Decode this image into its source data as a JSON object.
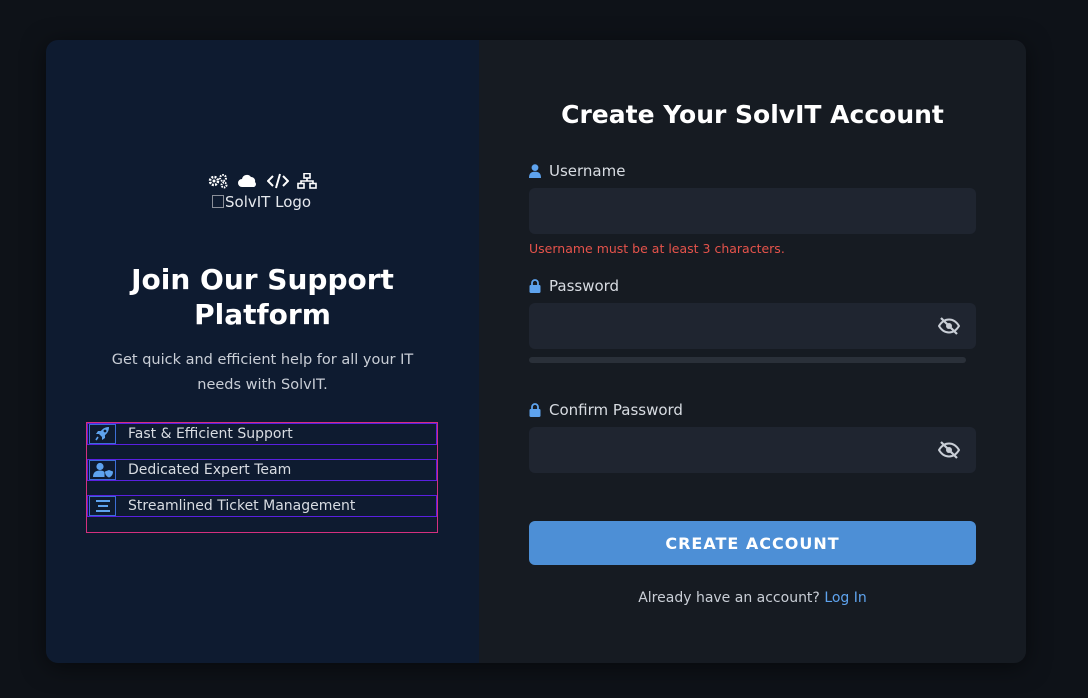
{
  "brand": {
    "logo_alt": "SolvIT Logo",
    "logo_icons": [
      "gears-icon",
      "cloud-icon",
      "code-icon",
      "network-icon"
    ]
  },
  "left": {
    "title": "Join Our Support Platform",
    "subtitle": "Get quick and efficient help for all your IT needs with SolvIT.",
    "features": [
      {
        "icon": "rocket-icon",
        "label": "Fast & Efficient Support"
      },
      {
        "icon": "user-shield-icon",
        "label": "Dedicated Expert Team"
      },
      {
        "icon": "list-icon",
        "label": "Streamlined Ticket Management"
      }
    ]
  },
  "form": {
    "title": "Create Your SolvIT Account",
    "username": {
      "label": "Username",
      "value": "",
      "placeholder": "",
      "error": "Username must be at least 3 characters."
    },
    "password": {
      "label": "Password",
      "value": "",
      "placeholder": "",
      "strength": 0
    },
    "confirm_password": {
      "label": "Confirm Password",
      "value": "",
      "placeholder": ""
    },
    "submit_label": "CREATE ACCOUNT",
    "login_prompt": "Already have an account?",
    "login_link": "Log In"
  },
  "colors": {
    "accent": "#4d8fd6",
    "link": "#5ea3ee",
    "error": "#e5534b",
    "left_panel": "#0e1b30",
    "right_panel": "#161b22"
  }
}
